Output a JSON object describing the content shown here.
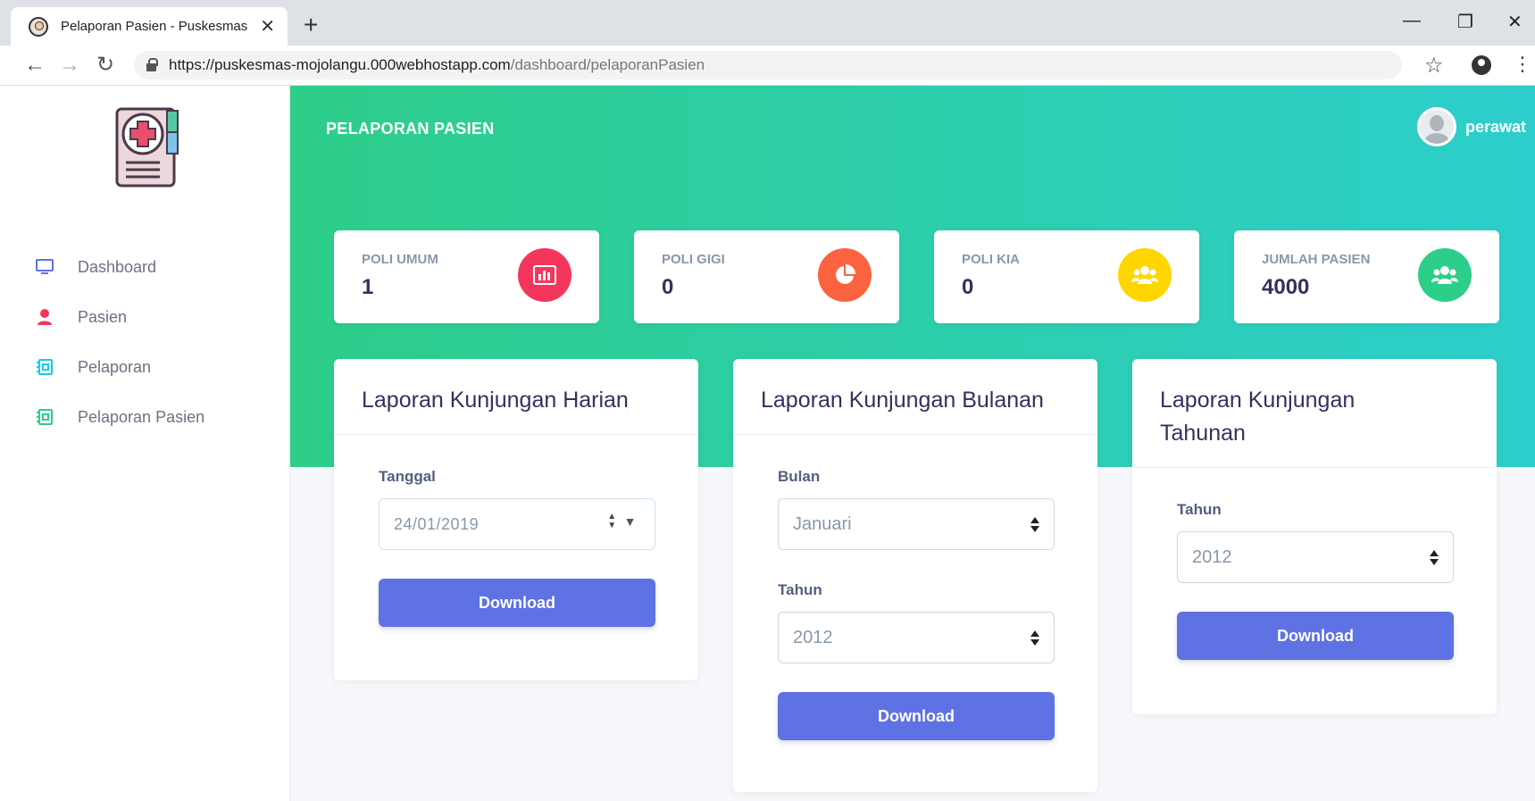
{
  "browser": {
    "tab_title": "Pelaporan Pasien - Puskesmas",
    "url_host": "https://puskesmas-mojolangu.000webhostapp.com",
    "url_path": "/dashboard/pelaporanPasien"
  },
  "sidebar": {
    "items": [
      {
        "label": "Dashboard",
        "icon": "monitor-icon"
      },
      {
        "label": "Pasien",
        "icon": "user-icon"
      },
      {
        "label": "Pelaporan",
        "icon": "report-icon"
      },
      {
        "label": "Pelaporan Pasien",
        "icon": "report-icon"
      }
    ]
  },
  "header": {
    "title": "PELAPORAN PASIEN",
    "user_name": "perawat"
  },
  "stats": [
    {
      "label": "POLI UMUM",
      "value": "1",
      "icon": "bar-chart-icon",
      "color": "#f5365c"
    },
    {
      "label": "POLI GIGI",
      "value": "0",
      "icon": "pie-chart-icon",
      "color": "#fb6340"
    },
    {
      "label": "POLI KIA",
      "value": "0",
      "icon": "users-icon",
      "color": "#ffd600"
    },
    {
      "label": "JUMLAH PASIEN",
      "value": "4000",
      "icon": "users-icon",
      "color": "#2dce89"
    }
  ],
  "cards": {
    "harian": {
      "title": "Laporan Kunjungan Harian",
      "date_label": "Tanggal",
      "date_value": "24/01/2019",
      "button": "Download"
    },
    "bulanan": {
      "title": "Laporan Kunjungan Bulanan",
      "month_label": "Bulan",
      "month_value": "Januari",
      "year_label": "Tahun",
      "year_value": "2012",
      "button": "Download"
    },
    "tahunan": {
      "title": "Laporan Kunjungan Tahunan",
      "year_label": "Tahun",
      "year_value": "2012",
      "button": "Download"
    }
  },
  "colors": {
    "accent": "#5e72e4",
    "header_gradient_start": "#2dce89",
    "header_gradient_end": "#2dcecc"
  }
}
